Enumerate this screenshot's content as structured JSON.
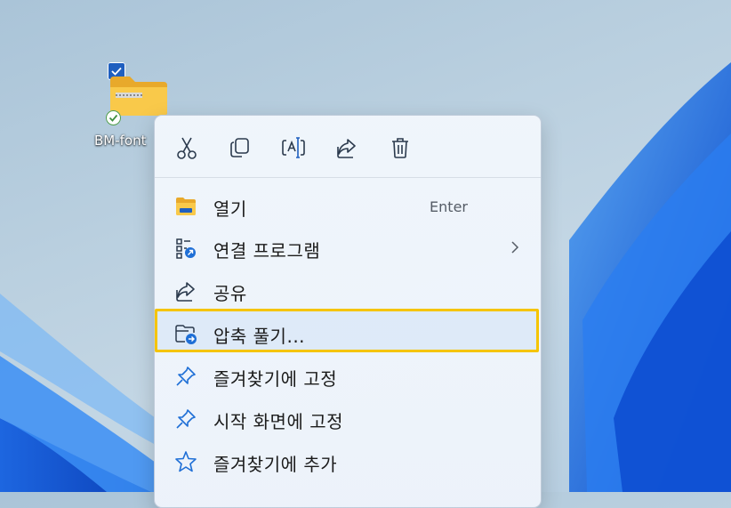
{
  "desktop": {
    "icon_label": "BM-font"
  },
  "context_menu": {
    "toolbar": [
      {
        "icon": "scissors-icon",
        "tooltip": "잘라내기"
      },
      {
        "icon": "copy-icon",
        "tooltip": "복사"
      },
      {
        "icon": "rename-icon",
        "tooltip": "이름 바꾸기"
      },
      {
        "icon": "share-icon",
        "tooltip": "공유"
      },
      {
        "icon": "trash-icon",
        "tooltip": "삭제"
      }
    ],
    "items": [
      {
        "label": "열기",
        "shortcut": "Enter",
        "icon": "folder-icon"
      },
      {
        "label": "연결 프로그램",
        "icon": "open-with-icon",
        "submenu": true
      },
      {
        "label": "공유",
        "icon": "share-icon"
      },
      {
        "label": "압축 풀기...",
        "icon": "extract-folder-icon",
        "highlighted": true
      },
      {
        "label": "즐겨찾기에 고정",
        "icon": "pin-icon"
      },
      {
        "label": "시작 화면에 고정",
        "icon": "pin-icon"
      },
      {
        "label": "즐겨찾기에 추가",
        "icon": "star-icon"
      }
    ]
  },
  "colors": {
    "highlight_border": "#f5c400",
    "accent": "#1f5fbf",
    "icon_stroke": "#2b3a4d"
  }
}
